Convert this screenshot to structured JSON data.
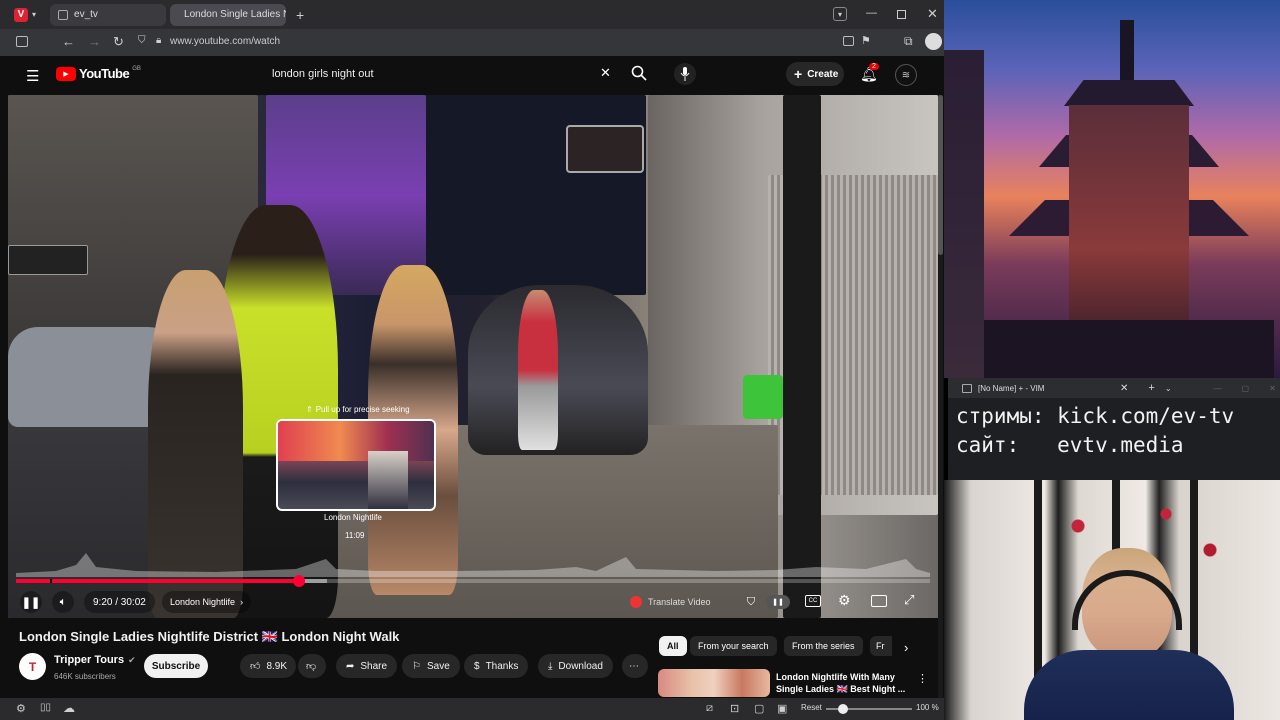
{
  "browser": {
    "tabs": [
      {
        "label": "ev_tv"
      },
      {
        "label": "London Single Ladies Nigh"
      }
    ],
    "url": "www.youtube.com/watch"
  },
  "youtube": {
    "logo_text": "YouTube",
    "region_code": "GB",
    "search": {
      "value": "london girls night out"
    },
    "create_label": "Create",
    "notification_count": "2"
  },
  "player": {
    "seek_hint": "Pull up for precise seeking",
    "preview_chapter": "London Nightlife",
    "preview_time": "11:09",
    "time_display": "9:20 / 30:02",
    "chapter": "London Nightlife",
    "translate_label": "Translate Video",
    "progress": 0.31,
    "buffered": 0.34,
    "hover_position": 0.37
  },
  "video_info": {
    "title": "London Single Ladies Nightlife District 🇬🇧 London Night Walk",
    "channel": "Tripper Tours",
    "subscribers": "646K subscribers",
    "subscribe_label": "Subscribe",
    "likes": "8.9K",
    "share_label": "Share",
    "save_label": "Save",
    "thanks_label": "Thanks",
    "download_label": "Download"
  },
  "recommendations": {
    "chips": [
      "All",
      "From your search",
      "From the series",
      "Fr"
    ],
    "first": {
      "title_line1": "London Nightlife With Many",
      "title_line2": "Single Ladies 🇬🇧 Best Night ..."
    }
  },
  "overlay": {
    "vim_title": "[No Name] + - VIM",
    "line1": "стримы: kick.com/ev-tv",
    "line2": "сайт:   evtv.media"
  },
  "statusbar": {
    "reset_label": "Reset",
    "zoom": "100 %"
  },
  "colors": {
    "accent_red": "#ff0000",
    "progress_red": "#f03",
    "vim_bg": "#1e1f22"
  }
}
